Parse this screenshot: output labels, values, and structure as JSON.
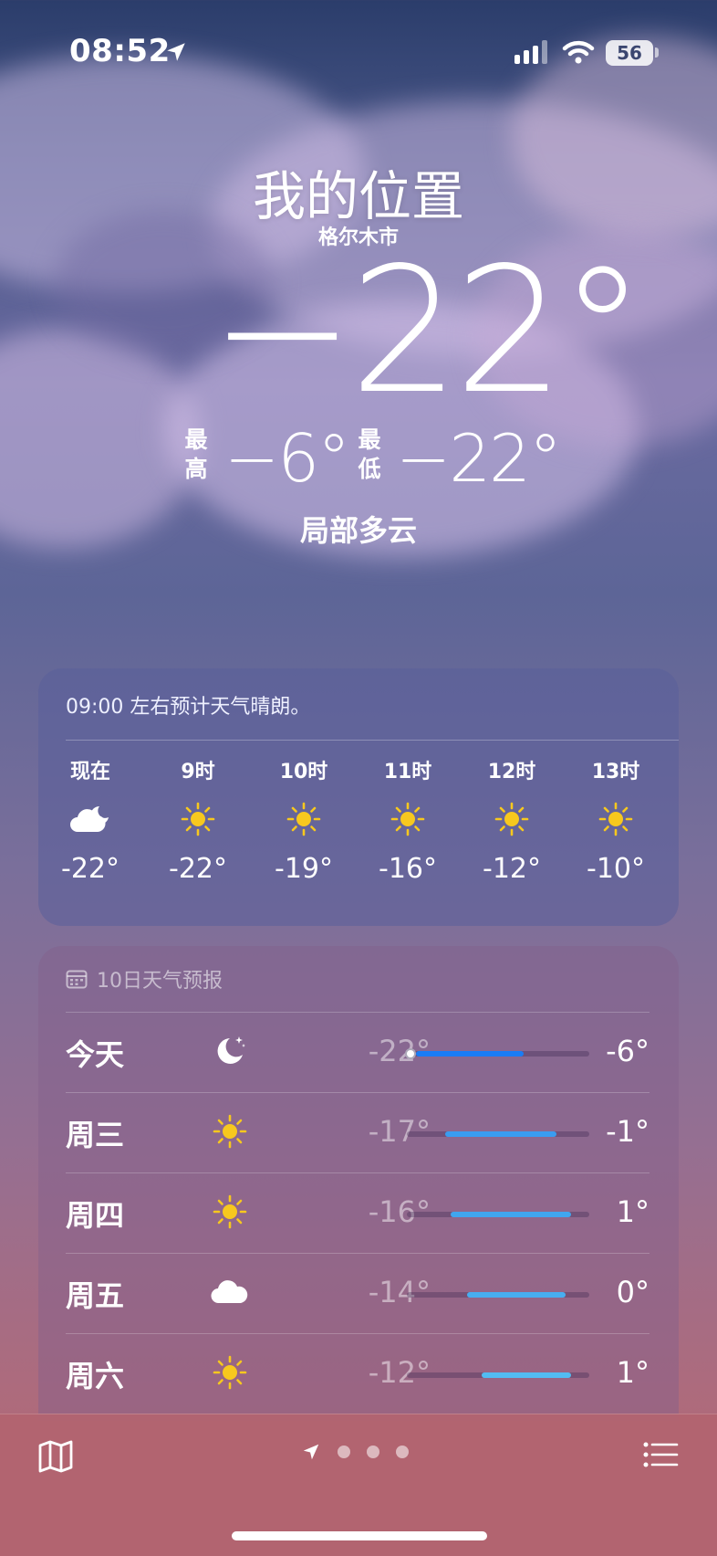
{
  "status_bar": {
    "time": "08:52",
    "battery": "56"
  },
  "location": {
    "title": "我的位置",
    "city": "格尔木市",
    "temperature": "−22°",
    "high_label": "最高",
    "high": "−6°",
    "low_label": "最低",
    "low": "−22°",
    "condition": "局部多云"
  },
  "hourly": {
    "summary": "09:00 左右预计天气晴朗。",
    "hours": [
      {
        "label": "现在",
        "icon": "partly-cloudy-night-icon",
        "temp": "-22°"
      },
      {
        "label": "9时",
        "icon": "sun-icon",
        "temp": "-22°"
      },
      {
        "label": "10时",
        "icon": "sun-icon",
        "temp": "-19°"
      },
      {
        "label": "11时",
        "icon": "sun-icon",
        "temp": "-16°"
      },
      {
        "label": "12时",
        "icon": "sun-icon",
        "temp": "-12°"
      },
      {
        "label": "13时",
        "icon": "sun-icon",
        "temp": "-10°"
      }
    ]
  },
  "daily": {
    "header": "10日天气预报",
    "days": [
      {
        "name": "今天",
        "icon": "moon-stars-icon",
        "low": "-22°",
        "high": "-6°",
        "bar_start": 0.05,
        "bar_end": 0.64,
        "bar_color": "#1a7cf5",
        "now_marker": 0.02
      },
      {
        "name": "周三",
        "icon": "sun-icon",
        "low": "-17°",
        "high": "-1°",
        "bar_start": 0.21,
        "bar_end": 0.82,
        "bar_color": "#3a9cf0"
      },
      {
        "name": "周四",
        "icon": "sun-icon",
        "low": "-16°",
        "high": "1°",
        "bar_start": 0.24,
        "bar_end": 0.9,
        "bar_color": "#40a6ef"
      },
      {
        "name": "周五",
        "icon": "cloud-icon",
        "low": "-14°",
        "high": "0°",
        "bar_start": 0.33,
        "bar_end": 0.87,
        "bar_color": "#48aef0"
      },
      {
        "name": "周六",
        "icon": "sun-icon",
        "low": "-12°",
        "high": "1°",
        "bar_start": 0.41,
        "bar_end": 0.9,
        "bar_color": "#52bcf2"
      }
    ]
  },
  "bottom_bar": {
    "pages": 3
  },
  "colors": {
    "sun": "#f7c81e",
    "accent_blue": "#1a7cf5"
  }
}
